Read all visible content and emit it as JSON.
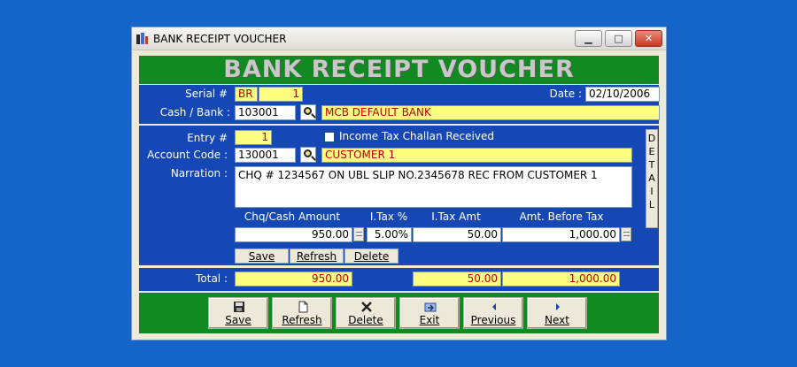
{
  "window": {
    "title": "BANK RECEIPT VOUCHER",
    "controls": [
      "minimize",
      "maximize",
      "close"
    ]
  },
  "header": {
    "title": "BANK RECEIPT VOUCHER"
  },
  "voucher": {
    "serial_label": "Serial #",
    "serial_prefix": "BR",
    "serial_number": "1",
    "date_label": "Date :",
    "date_value": "02/10/2006",
    "cash_bank_label": "Cash / Bank :",
    "cash_bank_code": "103001",
    "cash_bank_name": "MCB DEFAULT BANK"
  },
  "entry": {
    "entry_label": "Entry #",
    "entry_value": "1",
    "tax_challan_label": "Income Tax Challan Received",
    "tax_challan_checked": false,
    "account_label": "Account Code :",
    "account_code": "130001",
    "account_name": "CUSTOMER 1",
    "narration_label": "Narration :",
    "narration_value": "CHQ # 1234567 ON UBL SLIP NO.2345678 REC FROM CUSTOMER 1",
    "detail_label": [
      "D",
      "E",
      "T",
      "A",
      "I",
      "L"
    ],
    "columns": {
      "amount": "Chq/Cash Amount",
      "itax_pct": "I.Tax %",
      "itax_amt": "I.Tax Amt",
      "before_tax": "Amt. Before Tax"
    },
    "row": {
      "amount": "950.00",
      "itax_pct": "5.00%",
      "itax_amt": "50.00",
      "before_tax": "1,000.00"
    },
    "buttons": {
      "save": "Save",
      "refresh": "Refresh",
      "delete": "Delete"
    }
  },
  "totals": {
    "label": "Total :",
    "amount": "950.00",
    "itax_amt": "50.00",
    "before_tax": "1,000.00"
  },
  "toolbar": {
    "save": "Save",
    "refresh": "Refresh",
    "delete": "Delete",
    "exit": "Exit",
    "previous": "Previous",
    "next": "Next"
  },
  "colors": {
    "desktop": "#1565c8",
    "header_green": "#118a22",
    "panel_blue": "#1548b4",
    "field_yellow": "#ffff80",
    "value_red": "#c00000"
  }
}
